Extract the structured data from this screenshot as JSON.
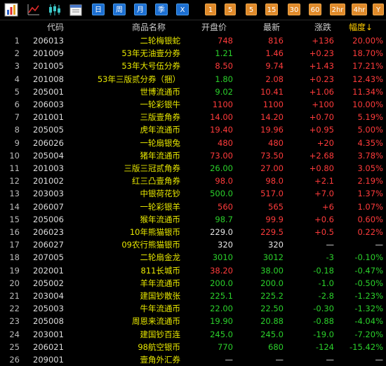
{
  "toolbar": {
    "blue_buttons": [
      "日",
      "周",
      "月",
      "季",
      "X"
    ],
    "orange_buttons": [
      "1",
      "5",
      "5",
      "15",
      "30",
      "60",
      "2hr",
      "4hr",
      "Y"
    ]
  },
  "table": {
    "headers": [
      "代码",
      "商品名称",
      "开盘价",
      "最新",
      "涨跌",
      "幅度↓"
    ],
    "rows": [
      {
        "idx": "1",
        "code": "206013",
        "name": "二轮梅银蛇",
        "open": "748",
        "last": "816",
        "chg": "+136",
        "pct": "20.00%",
        "oc": "up",
        "lc": "up",
        "dir": "up"
      },
      {
        "idx": "2",
        "code": "201009",
        "name": "53年无油壹分券",
        "open": "1.21",
        "last": "1.46",
        "chg": "+0.23",
        "pct": "18.70%",
        "oc": "dn",
        "lc": "up",
        "dir": "up"
      },
      {
        "idx": "3",
        "code": "201005",
        "name": "53年大号伍分券",
        "open": "8.50",
        "last": "9.74",
        "chg": "+1.43",
        "pct": "17.21%",
        "oc": "up",
        "lc": "up",
        "dir": "up"
      },
      {
        "idx": "4",
        "code": "201008",
        "name": "53年三版贰分券（捆）",
        "open": "1.80",
        "last": "2.08",
        "chg": "+0.23",
        "pct": "12.43%",
        "oc": "dn",
        "lc": "up",
        "dir": "up"
      },
      {
        "idx": "5",
        "code": "205001",
        "name": "世博流通币",
        "open": "9.02",
        "last": "10.41",
        "chg": "+1.06",
        "pct": "11.34%",
        "oc": "dn",
        "lc": "up",
        "dir": "up"
      },
      {
        "idx": "6",
        "code": "206003",
        "name": "一轮彩银牛",
        "open": "1100",
        "last": "1100",
        "chg": "+100",
        "pct": "10.00%",
        "oc": "up",
        "lc": "up",
        "dir": "up"
      },
      {
        "idx": "7",
        "code": "201001",
        "name": "三版壹角券",
        "open": "14.00",
        "last": "14.20",
        "chg": "+0.70",
        "pct": "5.19%",
        "oc": "up",
        "lc": "up",
        "dir": "up"
      },
      {
        "idx": "8",
        "code": "205005",
        "name": "虎年流通币",
        "open": "19.40",
        "last": "19.96",
        "chg": "+0.95",
        "pct": "5.00%",
        "oc": "up",
        "lc": "up",
        "dir": "up"
      },
      {
        "idx": "9",
        "code": "206026",
        "name": "一轮扇银兔",
        "open": "480",
        "last": "480",
        "chg": "+20",
        "pct": "4.35%",
        "oc": "up",
        "lc": "up",
        "dir": "up"
      },
      {
        "idx": "10",
        "code": "205004",
        "name": "猪年流通币",
        "open": "73.00",
        "last": "73.50",
        "chg": "+2.68",
        "pct": "3.78%",
        "oc": "up",
        "lc": "up",
        "dir": "up"
      },
      {
        "idx": "11",
        "code": "201003",
        "name": "三版三冠贰角券",
        "open": "26.00",
        "last": "27.00",
        "chg": "+0.80",
        "pct": "3.05%",
        "oc": "dn",
        "lc": "up",
        "dir": "up"
      },
      {
        "idx": "12",
        "code": "201002",
        "name": "红三凸壹角券",
        "open": "98.0",
        "last": "98.0",
        "chg": "+2.1",
        "pct": "2.19%",
        "oc": "up",
        "lc": "up",
        "dir": "up"
      },
      {
        "idx": "13",
        "code": "203003",
        "name": "中银荷花钞",
        "open": "500.0",
        "last": "517.0",
        "chg": "+7.0",
        "pct": "1.37%",
        "oc": "dn",
        "lc": "up",
        "dir": "up"
      },
      {
        "idx": "14",
        "code": "206007",
        "name": "一轮彩银羊",
        "open": "560",
        "last": "565",
        "chg": "+6",
        "pct": "1.07%",
        "oc": "up",
        "lc": "up",
        "dir": "up"
      },
      {
        "idx": "15",
        "code": "205006",
        "name": "猴年流通币",
        "open": "98.7",
        "last": "99.9",
        "chg": "+0.6",
        "pct": "0.60%",
        "oc": "dn",
        "lc": "up",
        "dir": "up"
      },
      {
        "idx": "16",
        "code": "206023",
        "name": "10年熊猫银币",
        "open": "229.0",
        "last": "229.5",
        "chg": "+0.5",
        "pct": "0.22%",
        "oc": "eq",
        "lc": "up",
        "dir": "up"
      },
      {
        "idx": "17",
        "code": "206027",
        "name": "09农行熊猫银币",
        "open": "320",
        "last": "320",
        "chg": "—",
        "pct": "—",
        "oc": "eq",
        "lc": "eq",
        "dir": "eq"
      },
      {
        "idx": "18",
        "code": "207005",
        "name": "二轮扇金龙",
        "open": "3010",
        "last": "3012",
        "chg": "-3",
        "pct": "-0.10%",
        "oc": "dn",
        "lc": "dn",
        "dir": "dn"
      },
      {
        "idx": "19",
        "code": "202001",
        "name": "811长城币",
        "open": "38.20",
        "last": "38.00",
        "chg": "-0.18",
        "pct": "-0.47%",
        "oc": "up",
        "lc": "dn",
        "dir": "dn"
      },
      {
        "idx": "20",
        "code": "205002",
        "name": "羊年流通币",
        "open": "200.0",
        "last": "200.0",
        "chg": "-1.0",
        "pct": "-0.50%",
        "oc": "dn",
        "lc": "dn",
        "dir": "dn"
      },
      {
        "idx": "21",
        "code": "203004",
        "name": "建国钞散张",
        "open": "225.1",
        "last": "225.2",
        "chg": "-2.8",
        "pct": "-1.23%",
        "oc": "dn",
        "lc": "dn",
        "dir": "dn"
      },
      {
        "idx": "22",
        "code": "205003",
        "name": "牛年流通币",
        "open": "22.00",
        "last": "22.50",
        "chg": "-0.30",
        "pct": "-1.32%",
        "oc": "dn",
        "lc": "dn",
        "dir": "dn"
      },
      {
        "idx": "23",
        "code": "205008",
        "name": "周恩来流通币",
        "open": "19.90",
        "last": "20.88",
        "chg": "-0.88",
        "pct": "-4.04%",
        "oc": "dn",
        "lc": "dn",
        "dir": "dn"
      },
      {
        "idx": "24",
        "code": "203001",
        "name": "建国钞百连",
        "open": "245.0",
        "last": "245.0",
        "chg": "-19.0",
        "pct": "-7.20%",
        "oc": "dn",
        "lc": "dn",
        "dir": "dn"
      },
      {
        "idx": "25",
        "code": "206021",
        "name": "98航空银币",
        "open": "770",
        "last": "680",
        "chg": "-124",
        "pct": "-15.42%",
        "oc": "dn",
        "lc": "dn",
        "dir": "dn"
      },
      {
        "idx": "26",
        "code": "209001",
        "name": "壹角外汇券",
        "open": "—",
        "last": "—",
        "chg": "—",
        "pct": "—",
        "oc": "eq",
        "lc": "eq",
        "dir": "eq"
      }
    ]
  },
  "colors": {
    "up": "#ff3b3b",
    "down": "#2bd12b",
    "flat": "#e6e6e6",
    "name": "#e8e800"
  }
}
